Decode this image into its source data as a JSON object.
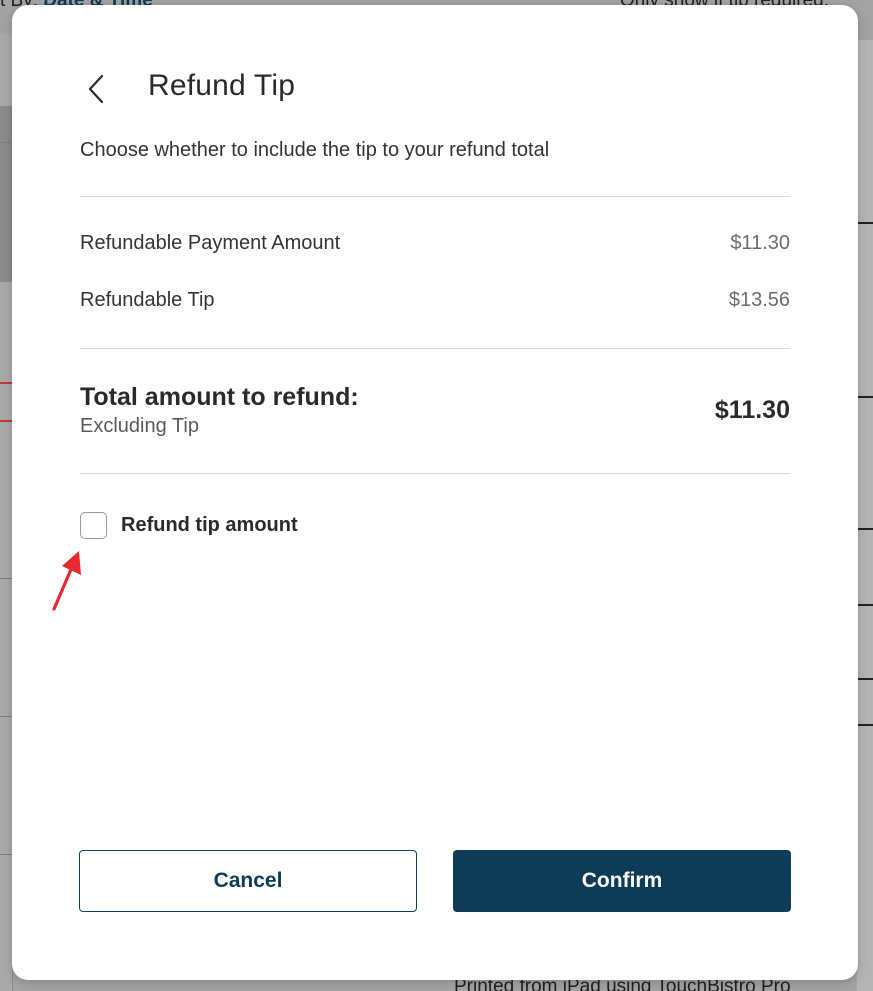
{
  "background": {
    "top_left_prefix": "t By:",
    "top_left_accent": "Date & Time",
    "top_right": "Only show if tip required:",
    "bottom_text": "Printed from iPad using TouchBistro Pro"
  },
  "modal": {
    "title": "Refund Tip",
    "subtitle": "Choose whether to include the tip to your refund total",
    "rows": [
      {
        "label": "Refundable Payment Amount",
        "value": "$11.30"
      },
      {
        "label": "Refundable Tip",
        "value": "$13.56"
      }
    ],
    "total": {
      "label": "Total amount to refund:",
      "sublabel": "Excluding Tip",
      "value": "$11.30"
    },
    "refund_tip": {
      "label": "Refund tip amount",
      "checked": false
    },
    "buttons": {
      "cancel": "Cancel",
      "confirm": "Confirm"
    }
  },
  "colors": {
    "primary": "#0e3c58",
    "annotation_arrow": "#e8292f"
  },
  "icons": {
    "back": "chevron-left-icon",
    "annotation": "red-arrow-icon"
  }
}
